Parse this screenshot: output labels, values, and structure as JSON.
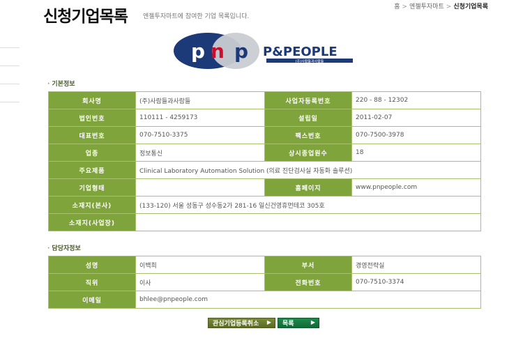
{
  "header": {
    "title": "신청기업목록",
    "subtitle": "엔젤투자마트에 참여한 기업 목록입니다.",
    "breadcrumb": [
      "홈",
      "엔젤투자마트",
      "신청기업목록"
    ]
  },
  "logo": {
    "mark": "pnp",
    "name": "P&PEOPLE",
    "tagline": "(주)사람들과사람들",
    "colors": {
      "navy": "#1c3a78",
      "gray": "#c9ccd2",
      "red": "#c8102e"
    }
  },
  "basic": {
    "section_title": "기본정보",
    "company_name_label": "회사명",
    "company_name": "(주)사람들과사람들",
    "biz_no_label": "사업자등록번호",
    "biz_no": "220 - 88 - 12302",
    "corp_no_label": "법인번호",
    "corp_no": "110111 - 4259173",
    "founded_label": "설립일",
    "founded": "2011-02-07",
    "phone_label": "대표번호",
    "phone": "070-7510-3375",
    "fax_label": "팩스번호",
    "fax": "070-7500-3978",
    "industry_label": "업종",
    "industry": "정보통신",
    "employees_label": "상시종업원수",
    "employees": "18",
    "product_label": "주요제품",
    "product": "Clinical Laboratory Automation Solution (의료 진단검사실 자동화 솔루션)",
    "form_label": "기업형태",
    "form": "",
    "homepage_label": "홈페이지",
    "homepage": "www.pnpeople.com",
    "hq_label": "소재지(본사)",
    "hq": "(133-120) 서울 성동구 성수동2가 281-16 일신건영휴먼테코 305호",
    "site_label": "소재지(사업장)",
    "site": ""
  },
  "contact": {
    "section_title": "담당자정보",
    "name_label": "성명",
    "name": "이백희",
    "dept_label": "부서",
    "dept": "경영전략실",
    "position_label": "직위",
    "position": "이사",
    "phone_label": "전화번호",
    "phone": "070-7510-3374",
    "email_label": "이메일",
    "email": "bhlee@pnpeople.com"
  },
  "buttons": {
    "interest": "관심기업등록취소",
    "list": "목록"
  },
  "colors": {
    "label_bg": "#80a43c",
    "border": "#a7c16c"
  }
}
